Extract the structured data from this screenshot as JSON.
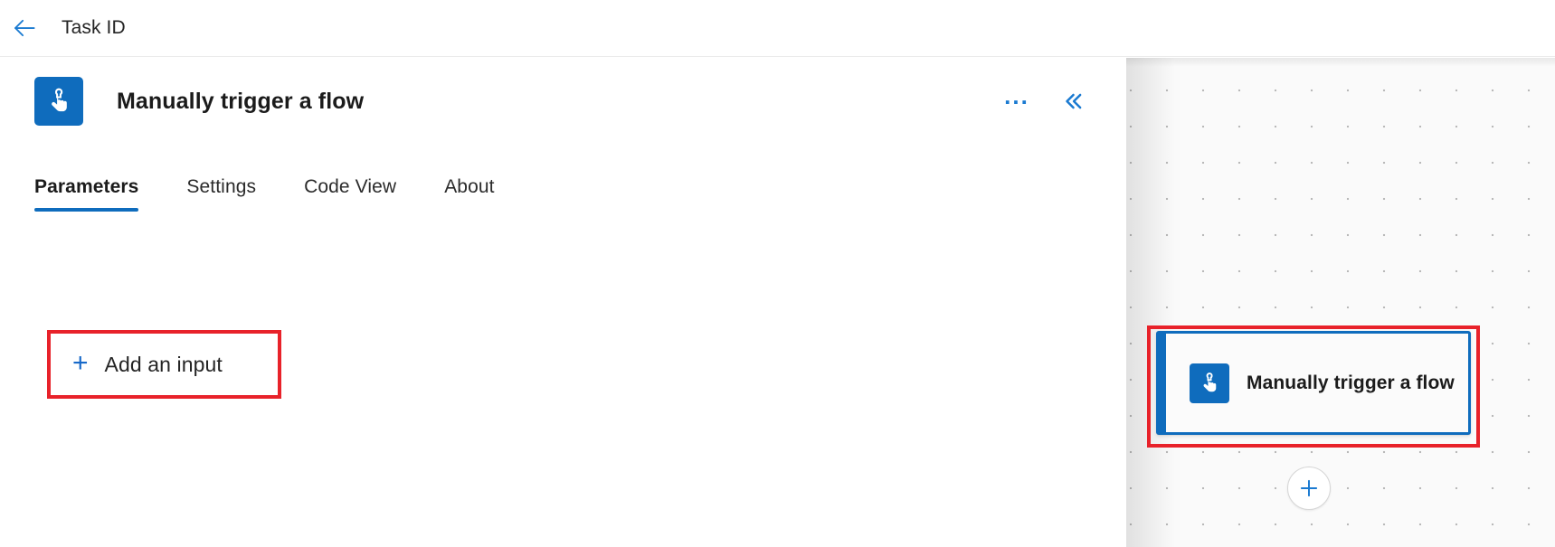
{
  "topbar": {
    "back_icon": "arrow-left-icon",
    "title": "Task ID"
  },
  "panel": {
    "icon": "manual-trigger-tap-icon",
    "title": "Manually trigger a flow",
    "more_actions_icon": "ellipsis-icon",
    "more_actions_label": "...",
    "collapse_icon": "chevron-double-left-icon",
    "collapse_label": "«",
    "tabs": [
      {
        "label": "Parameters",
        "active": true
      },
      {
        "label": "Settings",
        "active": false
      },
      {
        "label": "Code View",
        "active": false
      },
      {
        "label": "About",
        "active": false
      }
    ],
    "add_input": {
      "plus": "+",
      "label": "Add an input",
      "icon": "plus-icon",
      "highlighted": true
    }
  },
  "canvas": {
    "node": {
      "icon": "manual-trigger-tap-icon",
      "title": "Manually trigger a flow",
      "selected": true,
      "highlighted": true
    },
    "add_node": {
      "icon": "plus-icon",
      "label": "+"
    }
  },
  "colors": {
    "accent_blue": "#0f6cbd",
    "link_blue": "#1769c9",
    "annotation_red": "#e8222a",
    "text_primary": "#242424",
    "canvas_bg": "#fafafa",
    "grid_dot": "#b9b9b9"
  }
}
